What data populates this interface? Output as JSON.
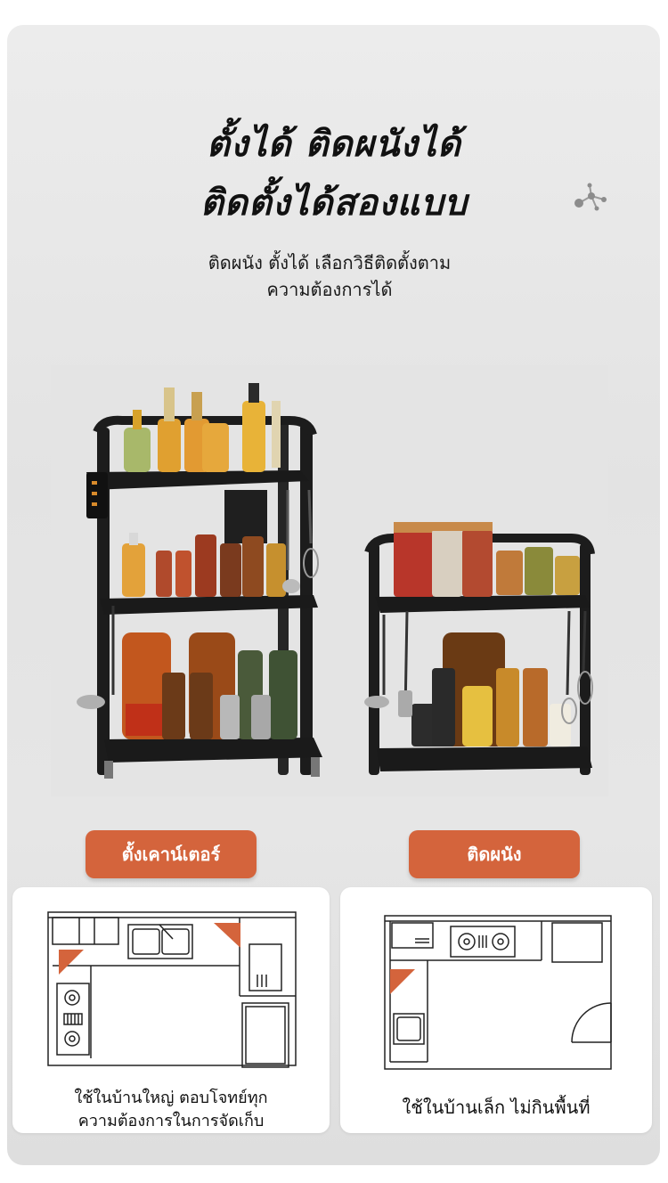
{
  "header": {
    "title_line1": "ตั้งได้ ติดผนังได้",
    "title_line2": "ติดตั้งได้สองแบบ",
    "subtitle_line1": "ติดผนัง ตั้งได้ เลือกวิธีติดตั้งตาม",
    "subtitle_line2": "ความต้องการได้"
  },
  "icons": {
    "decor": "molecule-icon"
  },
  "options": [
    {
      "label": "ตั้งเคาน์เตอร์",
      "caption_line1": "ใช้ในบ้านใหญ่ ตอบโจทย์ทุก",
      "caption_line2": "ความต้องการในการจัดเก็บ"
    },
    {
      "label": "ติดผนัง",
      "caption_line1": "ใช้ในบ้านเล็ก ไม่กินพื้นที่",
      "caption_line2": ""
    }
  ],
  "colors": {
    "accent": "#d4643c",
    "background": "#e6e6e6",
    "rack": "#1c1c1c"
  }
}
